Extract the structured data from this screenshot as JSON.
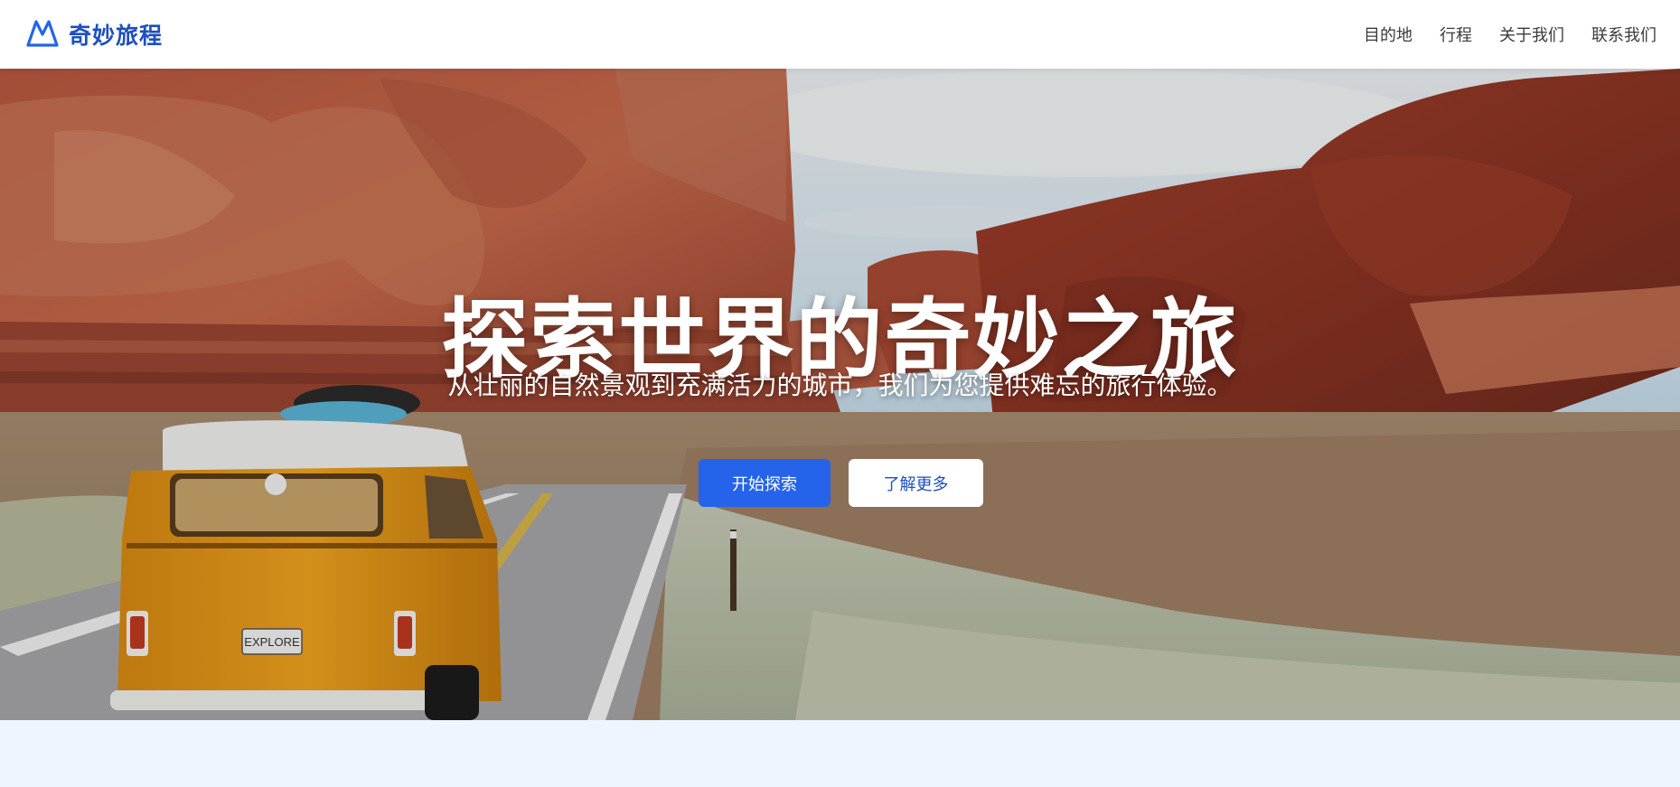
{
  "brand": {
    "name": "奇妙旅程",
    "color": "#1e4fbf"
  },
  "nav": {
    "items": [
      {
        "label": "目的地"
      },
      {
        "label": "行程"
      },
      {
        "label": "关于我们"
      },
      {
        "label": "联系我们"
      }
    ]
  },
  "hero": {
    "title": "探索世界的奇妙之旅",
    "subtitle": "从壮丽的自然景观到充满活力的城市，我们为您提供难忘的旅行体验。",
    "primary_button": "开始探索",
    "secondary_button": "了解更多",
    "background_image": "desert canyon road with yellow van",
    "van_plate": "EXPLORE"
  },
  "colors": {
    "accent": "#2563eb",
    "page_bg": "#eef5ff"
  }
}
